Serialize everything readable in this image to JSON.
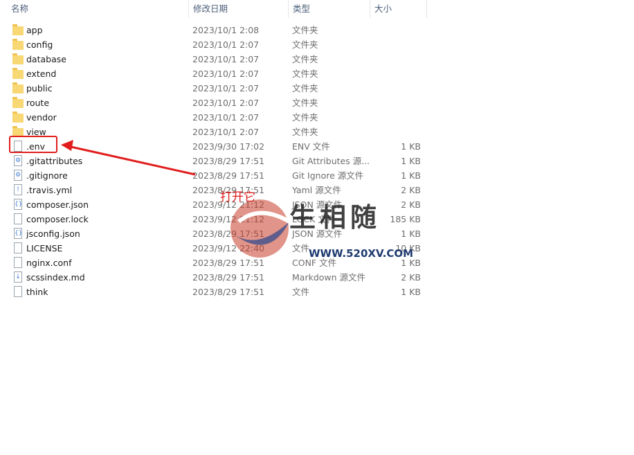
{
  "header": {
    "name": "名称",
    "date": "修改日期",
    "type": "类型",
    "size": "大小"
  },
  "files": [
    {
      "name": "app",
      "date": "2023/10/1 2:08",
      "type": "文件夹",
      "size": "",
      "icon": "folder"
    },
    {
      "name": "config",
      "date": "2023/10/1 2:07",
      "type": "文件夹",
      "size": "",
      "icon": "folder"
    },
    {
      "name": "database",
      "date": "2023/10/1 2:07",
      "type": "文件夹",
      "size": "",
      "icon": "folder"
    },
    {
      "name": "extend",
      "date": "2023/10/1 2:07",
      "type": "文件夹",
      "size": "",
      "icon": "folder"
    },
    {
      "name": "public",
      "date": "2023/10/1 2:07",
      "type": "文件夹",
      "size": "",
      "icon": "folder"
    },
    {
      "name": "route",
      "date": "2023/10/1 2:07",
      "type": "文件夹",
      "size": "",
      "icon": "folder"
    },
    {
      "name": "vendor",
      "date": "2023/10/1 2:07",
      "type": "文件夹",
      "size": "",
      "icon": "folder"
    },
    {
      "name": "view",
      "date": "2023/10/1 2:07",
      "type": "文件夹",
      "size": "",
      "icon": "folder"
    },
    {
      "name": ".env",
      "date": "2023/9/30 17:02",
      "type": "ENV 文件",
      "size": "1 KB",
      "icon": "file"
    },
    {
      "name": ".gitattributes",
      "date": "2023/8/29 17:51",
      "type": "Git Attributes 源...",
      "size": "1 KB",
      "icon": "gear-file"
    },
    {
      "name": ".gitignore",
      "date": "2023/8/29 17:51",
      "type": "Git Ignore 源文件",
      "size": "1 KB",
      "icon": "gear-file"
    },
    {
      "name": ".travis.yml",
      "date": "2023/8/29 17:51",
      "type": "Yaml 源文件",
      "size": "2 KB",
      "icon": "yml-file"
    },
    {
      "name": "composer.json",
      "date": "2023/9/12 21:12",
      "type": "JSON 源文件",
      "size": "2 KB",
      "icon": "json-file"
    },
    {
      "name": "composer.lock",
      "date": "2023/9/12 21:12",
      "type": "LOCK 文件",
      "size": "185 KB",
      "icon": "file"
    },
    {
      "name": "jsconfig.json",
      "date": "2023/8/29 17:51",
      "type": "JSON 源文件",
      "size": "1 KB",
      "icon": "json-file"
    },
    {
      "name": "LICENSE",
      "date": "2023/9/12 22:40",
      "type": "文件",
      "size": "10 KB",
      "icon": "file"
    },
    {
      "name": "nginx.conf",
      "date": "2023/8/29 17:51",
      "type": "CONF 文件",
      "size": "1 KB",
      "icon": "file"
    },
    {
      "name": "scssindex.md",
      "date": "2023/8/29 17:51",
      "type": "Markdown 源文件",
      "size": "2 KB",
      "icon": "md-file"
    },
    {
      "name": "think",
      "date": "2023/8/29 17:51",
      "type": "文件",
      "size": "1 KB",
      "icon": "file"
    }
  ],
  "annotation": {
    "note": "打开它",
    "color": "#e11c1c"
  },
  "watermark": {
    "text": "生相随",
    "url": "WWW.520XV.COM"
  }
}
